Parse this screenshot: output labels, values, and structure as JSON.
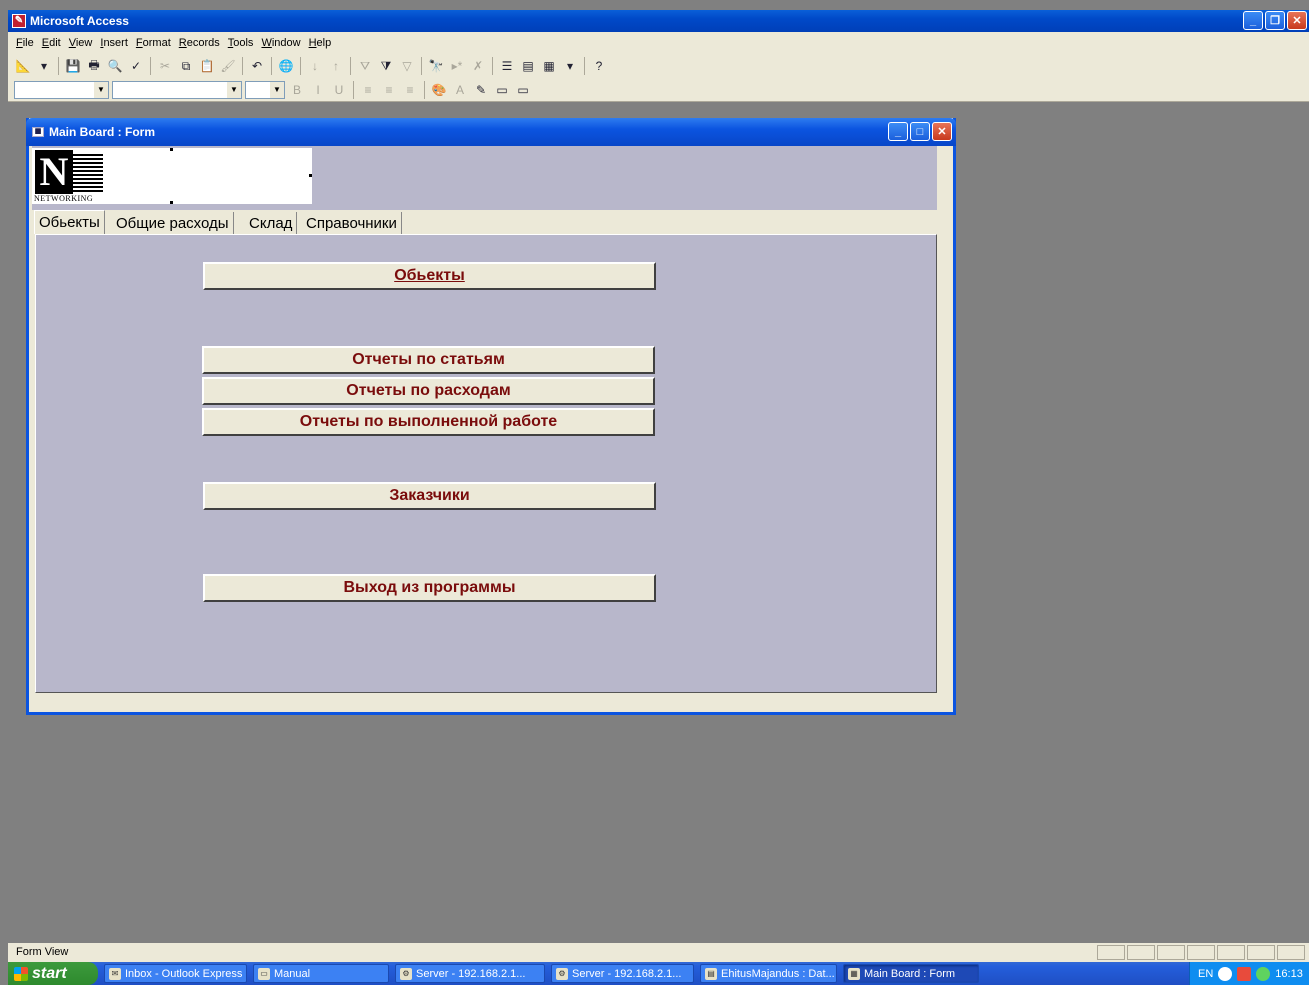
{
  "app": {
    "title": "Microsoft Access",
    "menu": [
      "File",
      "Edit",
      "View",
      "Insert",
      "Format",
      "Records",
      "Tools",
      "Window",
      "Help"
    ]
  },
  "toolbar": {
    "icons": [
      "view-icon",
      "save-icon",
      "print-icon",
      "print-preview-icon",
      "spelling-icon",
      "cut-icon",
      "copy-icon",
      "paste-icon",
      "format-painter-icon",
      "undo-icon",
      "hyperlink-icon",
      "sort-ascending-icon",
      "sort-descending-icon",
      "filter-by-selection-icon",
      "filter-by-form-icon",
      "apply-filter-icon",
      "find-icon",
      "new-record-icon",
      "delete-record-icon",
      "properties-icon",
      "database-window-icon",
      "new-object-icon",
      "help-icon"
    ]
  },
  "form": {
    "title": "Main Board : Form",
    "logo_text": "NETWORKING",
    "tabs": [
      "Обьекты",
      "Общие расходы",
      "Склад",
      "Справочники"
    ],
    "buttons": {
      "objects": "Обьекты",
      "reports_articles": "Отчеты по статьям",
      "reports_expenses": "Отчеты по расходам",
      "reports_work": "Отчеты по выполненной работе",
      "customers": "Заказчики",
      "exit": "Выход из программы"
    }
  },
  "status": {
    "text": "Form View"
  },
  "taskbar": {
    "start": "start",
    "tasks": [
      "Inbox - Outlook Express",
      "Manual",
      "Server - 192.168.2.1...",
      "Server - 192.168.2.1...",
      "EhitusMajandus : Dat...",
      "Main Board : Form"
    ],
    "tray": {
      "lang": "EN",
      "clock": "16:13"
    }
  }
}
